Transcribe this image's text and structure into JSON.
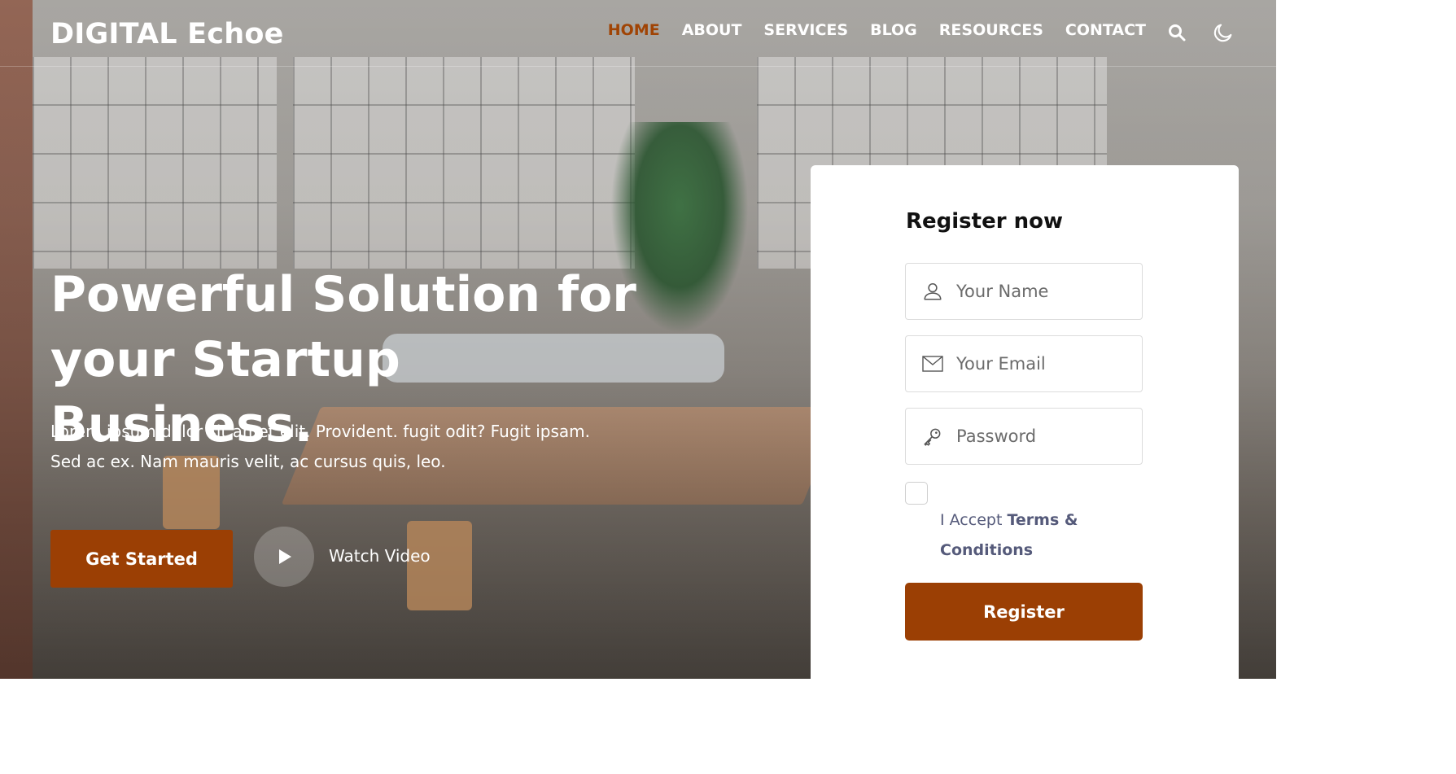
{
  "header": {
    "brand": "DIGITAL Echoe",
    "nav": [
      {
        "label": "HOME",
        "active": true
      },
      {
        "label": "ABOUT",
        "active": false
      },
      {
        "label": "SERVICES",
        "active": false
      },
      {
        "label": "BLOG",
        "active": false
      },
      {
        "label": "RESOURCES",
        "active": false
      },
      {
        "label": "CONTACT",
        "active": false
      }
    ],
    "icons": [
      "search-icon",
      "moon-icon"
    ]
  },
  "hero": {
    "title_line1": "Powerful Solution for",
    "title_line2": "your Startup Business.",
    "description_line1": "Lorem ipsum dolor sit amet elit. Provident. fugit odit? Fugit ipsam.",
    "description_line2": "Sed ac ex. Nam mauris velit, ac cursus quis, leo.",
    "cta_label": "Get Started",
    "video_label": "Watch Video"
  },
  "register": {
    "title": "Register now",
    "name_placeholder": "Your Name",
    "email_placeholder": "Your Email",
    "password_placeholder": "Password",
    "accept_prefix": "I Accept ",
    "terms_label": "Terms & Conditions",
    "submit_label": "Register"
  },
  "colors": {
    "accent": "#9b3f04",
    "nav_active": "#a04405",
    "link_text": "#555a7a"
  }
}
